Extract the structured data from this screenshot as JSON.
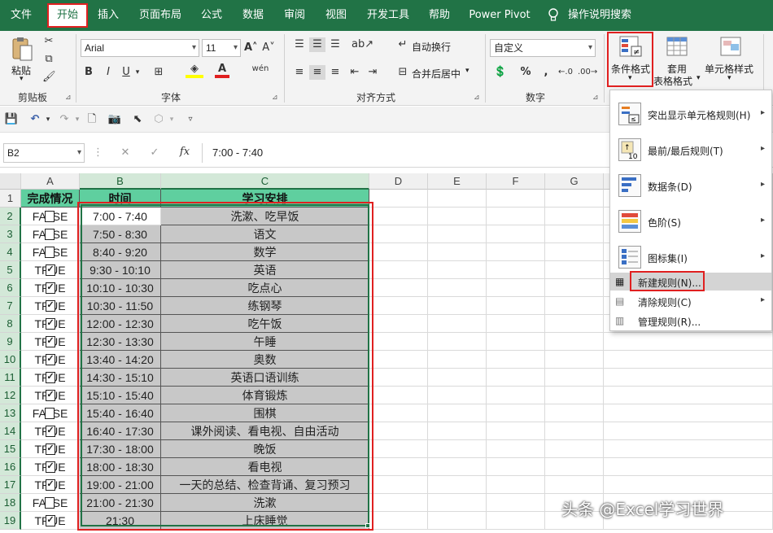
{
  "tabs": [
    "文件",
    "开始",
    "插入",
    "页面布局",
    "公式",
    "数据",
    "审阅",
    "视图",
    "开发工具",
    "帮助",
    "Power Pivot",
    "操作说明搜索"
  ],
  "ribbon": {
    "clipboard": {
      "paste": "粘贴",
      "label": "剪贴板"
    },
    "font": {
      "name": "Arial",
      "size": "11",
      "bold": "B",
      "italic": "I",
      "underline": "U",
      "label": "字体",
      "phonetic": "wén"
    },
    "alignment": {
      "wrap": "自动换行",
      "merge": "合并后居中",
      "label": "对齐方式"
    },
    "number": {
      "format": "自定义",
      "percent": "%",
      "comma": ",",
      "label": "数字"
    },
    "styles": {
      "conditional": "条件格式",
      "table_line1": "套用",
      "table_line2": "表格格式",
      "cell_styles": "单元格样式"
    }
  },
  "formula_bar": {
    "name_box": "B2",
    "fx": "fx",
    "value": "7:00 - 7:40"
  },
  "columns": [
    "A",
    "B",
    "C",
    "D",
    "E",
    "F",
    "G"
  ],
  "headers": {
    "a": "完成情况",
    "b": "时间",
    "c": "学习安排"
  },
  "rows": [
    {
      "num": "1"
    },
    {
      "num": "2",
      "a": "FALSE",
      "b": "7:00 - 7:40",
      "c": "洗漱、吃早饭"
    },
    {
      "num": "3",
      "a": "FALSE",
      "b": "7:50 - 8:30",
      "c": "语文"
    },
    {
      "num": "4",
      "a": "FALSE",
      "b": "8:40 - 9:20",
      "c": "数学"
    },
    {
      "num": "5",
      "a": "TRUE",
      "b": "9:30 - 10:10",
      "c": "英语"
    },
    {
      "num": "6",
      "a": "TRUE",
      "b": "10:10 - 10:30",
      "c": "吃点心"
    },
    {
      "num": "7",
      "a": "TRUE",
      "b": "10:30 - 11:50",
      "c": "练钢琴"
    },
    {
      "num": "8",
      "a": "TRUE",
      "b": "12:00 - 12:30",
      "c": "吃午饭"
    },
    {
      "num": "9",
      "a": "TRUE",
      "b": "12:30 - 13:30",
      "c": "午睡"
    },
    {
      "num": "10",
      "a": "TRUE",
      "b": "13:40 - 14:20",
      "c": "奥数"
    },
    {
      "num": "11",
      "a": "TRUE",
      "b": "14:30 - 15:10",
      "c": "英语口语训练"
    },
    {
      "num": "12",
      "a": "TRUE",
      "b": "15:10 - 15:40",
      "c": "体育锻炼"
    },
    {
      "num": "13",
      "a": "FALSE",
      "b": "15:40 - 16:40",
      "c": "围棋"
    },
    {
      "num": "14",
      "a": "TRUE",
      "b": "16:40 - 17:30",
      "c": "课外阅读、看电视、自由活动"
    },
    {
      "num": "15",
      "a": "TRUE",
      "b": "17:30 - 18:00",
      "c": "晚饭"
    },
    {
      "num": "16",
      "a": "TRUE",
      "b": "18:00 - 18:30",
      "c": "看电视"
    },
    {
      "num": "17",
      "a": "TRUE",
      "b": "19:00 - 21:00",
      "c": "一天的总结、检查背诵、复习预习"
    },
    {
      "num": "18",
      "a": "FALSE",
      "b": "21:00 - 21:30",
      "c": "洗漱"
    },
    {
      "num": "19",
      "a": "TRUE",
      "b": "21:30",
      "c": "上床睡觉"
    }
  ],
  "menu": [
    {
      "label": "突出显示单元格规则(H)",
      "arrow": "▸"
    },
    {
      "label": "最前/最后规则(T)",
      "arrow": "▸"
    },
    {
      "label": "数据条(D)",
      "arrow": "▸"
    },
    {
      "label": "色阶(S)",
      "arrow": "▸"
    },
    {
      "label": "图标集(I)",
      "arrow": "▸"
    },
    {
      "label": "新建规则(N)..."
    },
    {
      "label": "清除规则(C)",
      "arrow": "▸"
    },
    {
      "label": "管理规则(R)..."
    }
  ],
  "watermark": "头条 @Excel学习世界",
  "colors": {
    "excel_green": "#217346",
    "header_fill": "#5fcf9f",
    "cell_fill": "#c8c8c8",
    "highlight_red": "#e02020"
  }
}
